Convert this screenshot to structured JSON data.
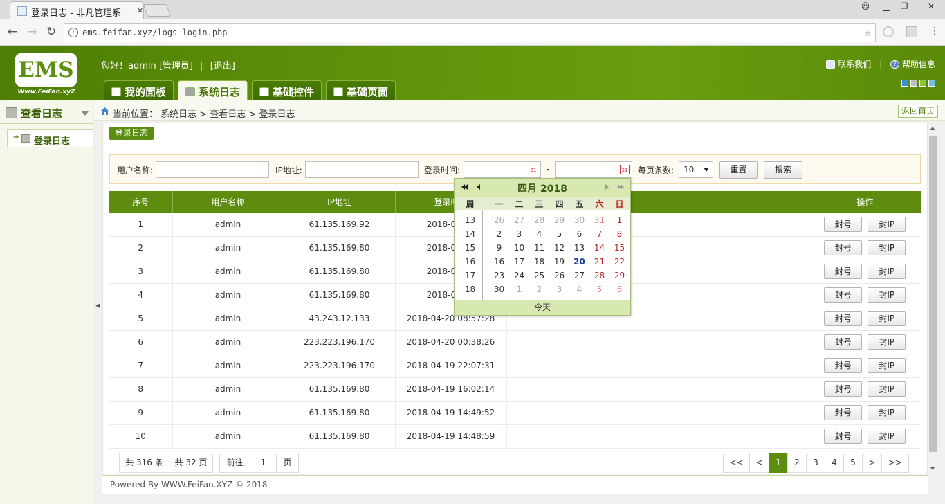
{
  "browser": {
    "tab_title": "登录日志 - 非凡管理系",
    "url": "ems.feifan.xyz/logs-login.php"
  },
  "header": {
    "logo_text": "EMS",
    "logo_sub": "Www.FeiFan.xyZ",
    "greeting": "您好！admin [管理员]",
    "logout": "[退出]",
    "contact": "联系我们",
    "help": "帮助信息",
    "tabs": [
      {
        "label": "我的面板"
      },
      {
        "label": "系统日志"
      },
      {
        "label": "基础控件"
      },
      {
        "label": "基础页面"
      }
    ],
    "active_tab": 1
  },
  "sidebar": {
    "heading": "查看日志",
    "items": [
      {
        "label": "登录日志"
      }
    ]
  },
  "breadcrumb": {
    "label": "当前位置：",
    "path": "系统日志 > 查看日志 > 登录日志",
    "back_home": "返回首页"
  },
  "section": {
    "title": "登录日志"
  },
  "search": {
    "username_label": "用户名称:",
    "ip_label": "IP地址:",
    "time_label": "登录时间:",
    "date_sep": "-",
    "page_size_label": "每页条数:",
    "page_size": "10",
    "reset_label": "重置",
    "search_label": "搜索",
    "calendar_icon_text": "31"
  },
  "table": {
    "columns": [
      "序号",
      "用户名称",
      "IP地址",
      "登录时间",
      "",
      "操作"
    ],
    "rows": [
      {
        "id": "1",
        "user": "admin",
        "ip": "61.135.169.92",
        "time": "2018-04-20"
      },
      {
        "id": "2",
        "user": "admin",
        "ip": "61.135.169.80",
        "time": "2018-04-20"
      },
      {
        "id": "3",
        "user": "admin",
        "ip": "61.135.169.80",
        "time": "2018-04-20"
      },
      {
        "id": "4",
        "user": "admin",
        "ip": "61.135.169.80",
        "time": "2018-04-20"
      },
      {
        "id": "5",
        "user": "admin",
        "ip": "43.243.12.133",
        "time": "2018-04-20 08:57:28"
      },
      {
        "id": "6",
        "user": "admin",
        "ip": "223.223.196.170",
        "time": "2018-04-20 00:38:26"
      },
      {
        "id": "7",
        "user": "admin",
        "ip": "223.223.196.170",
        "time": "2018-04-19 22:07:31"
      },
      {
        "id": "8",
        "user": "admin",
        "ip": "61.135.169.80",
        "time": "2018-04-19 16:02:14"
      },
      {
        "id": "9",
        "user": "admin",
        "ip": "61.135.169.80",
        "time": "2018-04-19 14:49:52"
      },
      {
        "id": "10",
        "user": "admin",
        "ip": "61.135.169.80",
        "time": "2018-04-19 14:48:59"
      }
    ],
    "ban_account": "封号",
    "ban_ip": "封IP"
  },
  "pager": {
    "total_records": "共 316 条",
    "total_pages": "共 32 页",
    "goto_label": "前往",
    "goto_value": "1",
    "page_unit": "页",
    "first": "<<",
    "prev": "<",
    "pages": [
      "1",
      "2",
      "3",
      "4",
      "5"
    ],
    "current": "1",
    "next": ">",
    "last": ">>"
  },
  "footer": {
    "text": "Powered By WWW.FeiFan.XYZ © 2018"
  },
  "calendar": {
    "title": "四月 2018",
    "weekday_header": [
      "周",
      "一",
      "二",
      "三",
      "四",
      "五",
      "六",
      "日"
    ],
    "weeks": [
      {
        "wn": "13",
        "days": [
          "26",
          "27",
          "28",
          "29",
          "30",
          "31",
          "1"
        ]
      },
      {
        "wn": "14",
        "days": [
          "2",
          "3",
          "4",
          "5",
          "6",
          "7",
          "8"
        ]
      },
      {
        "wn": "15",
        "days": [
          "9",
          "10",
          "11",
          "12",
          "13",
          "14",
          "15"
        ]
      },
      {
        "wn": "16",
        "days": [
          "16",
          "17",
          "18",
          "19",
          "20",
          "21",
          "22"
        ]
      },
      {
        "wn": "17",
        "days": [
          "23",
          "24",
          "25",
          "26",
          "27",
          "28",
          "29"
        ]
      },
      {
        "wn": "18",
        "days": [
          "30",
          "1",
          "2",
          "3",
          "4",
          "5",
          "6"
        ]
      }
    ],
    "today_label": "今天",
    "highlight_day": "20"
  }
}
